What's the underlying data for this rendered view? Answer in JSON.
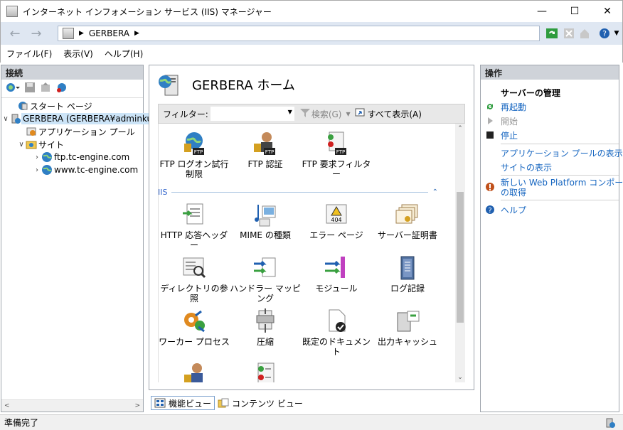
{
  "window": {
    "title": "インターネット インフォメーション サービス (IIS) マネージャー"
  },
  "address": {
    "path": "GERBERA"
  },
  "menu": {
    "file": "ファイル(F)",
    "view": "表示(V)",
    "help": "ヘルプ(H)"
  },
  "left": {
    "header": "接続",
    "tree": {
      "start": "スタート ページ",
      "server": "GERBERA (GERBERA¥adminku",
      "apppools": "アプリケーション プール",
      "sites": "サイト",
      "site1": "ftp.tc-engine.com",
      "site2": "www.tc-engine.com"
    }
  },
  "center": {
    "title": "GERBERA ホーム",
    "filter_label": "フィルター:",
    "search": "検索(G)",
    "show_all": "すべて表示(A)",
    "group_iis": "IIS",
    "features": {
      "ftp_logon": "FTP ログオン試行制限",
      "ftp_auth": "FTP 認証",
      "ftp_filter": "FTP 要求フィルター",
      "http_headers": "HTTP 応答ヘッダー",
      "mime": "MIME の種類",
      "error_pages": "エラー ページ",
      "server_cert": "サーバー証明書",
      "dir_browse": "ディレクトリの参照",
      "handler": "ハンドラー マッピング",
      "modules": "モジュール",
      "logging": "ログ記録",
      "worker": "ワーカー プロセス",
      "compression": "圧縮",
      "default_doc": "既定のドキュメント",
      "output_cache": "出力キャッシュ"
    }
  },
  "view_tabs": {
    "features": "機能ビュー",
    "content": "コンテンツ ビュー"
  },
  "right": {
    "header": "操作",
    "server_mgmt": "サーバーの管理",
    "restart": "再起動",
    "start": "開始",
    "stop": "停止",
    "view_apppools": "アプリケーション プールの表示",
    "view_sites": "サイトの表示",
    "web_platform": "新しい Web Platform コンポーネント\nの取得",
    "web_platform_l1": "新しい Web Platform コンポーネント",
    "web_platform_l2": "の取得",
    "help": "ヘルプ"
  },
  "status": {
    "text": "準備完了"
  }
}
